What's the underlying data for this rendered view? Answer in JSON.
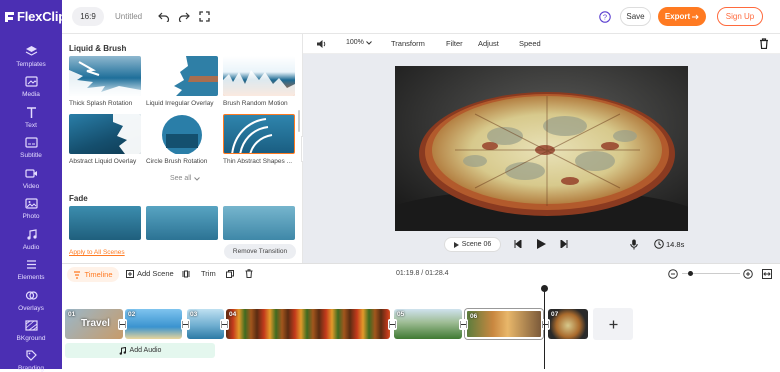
{
  "app": {
    "logo_text": "FlexClip"
  },
  "nav": {
    "items": [
      {
        "label": "Templates",
        "icon": "templates-icon"
      },
      {
        "label": "Media",
        "icon": "media-icon"
      },
      {
        "label": "Text",
        "icon": "text-icon"
      },
      {
        "label": "Subtitle",
        "icon": "subtitle-icon"
      },
      {
        "label": "Video",
        "icon": "video-icon"
      },
      {
        "label": "Photo",
        "icon": "photo-icon"
      },
      {
        "label": "Audio",
        "icon": "audio-icon"
      },
      {
        "label": "Elements",
        "icon": "elements-icon"
      },
      {
        "label": "Overlays",
        "icon": "overlays-icon"
      },
      {
        "label": "BKground",
        "icon": "background-icon"
      },
      {
        "label": "Branding",
        "icon": "branding-icon"
      }
    ]
  },
  "topbar": {
    "aspect": "16:9",
    "project_name": "Untitled",
    "save": "Save",
    "export": "Export",
    "signup": "Sign Up"
  },
  "library": {
    "section1_title": "Liquid & Brush",
    "section2_title": "Fade",
    "items": [
      {
        "label": "Thick Splash Rotation"
      },
      {
        "label": "Liquid Irregular Overlay"
      },
      {
        "label": "Brush Random Motion"
      },
      {
        "label": "Abstract Liquid Overlay"
      },
      {
        "label": "Circle Brush Rotation"
      },
      {
        "label": "Thin Abstract Shapes ..."
      }
    ],
    "see_all": "See all",
    "apply_all": "Apply to All Scenes",
    "remove": "Remove Transition"
  },
  "editbar": {
    "zoom": "100%",
    "transform": "Transform",
    "filter": "Filter",
    "adjust": "Adjust",
    "speed": "Speed"
  },
  "player": {
    "scene": "Scene  06",
    "duration": "14.8s"
  },
  "timeline": {
    "tab": "Timeline",
    "add_scene": "Add Scene",
    "trim": "Trim",
    "time": "01:19.8 / 01:28.4",
    "add_audio": "Add Audio",
    "clips": [
      {
        "num": "01",
        "title": "Travel"
      },
      {
        "num": "02"
      },
      {
        "num": "03"
      },
      {
        "num": "04"
      },
      {
        "num": "05"
      },
      {
        "num": "06"
      },
      {
        "num": "07"
      }
    ]
  },
  "colors": {
    "brand": "#4b2fb3",
    "accent": "#ff7a21",
    "signup": "#ff6a3d"
  }
}
